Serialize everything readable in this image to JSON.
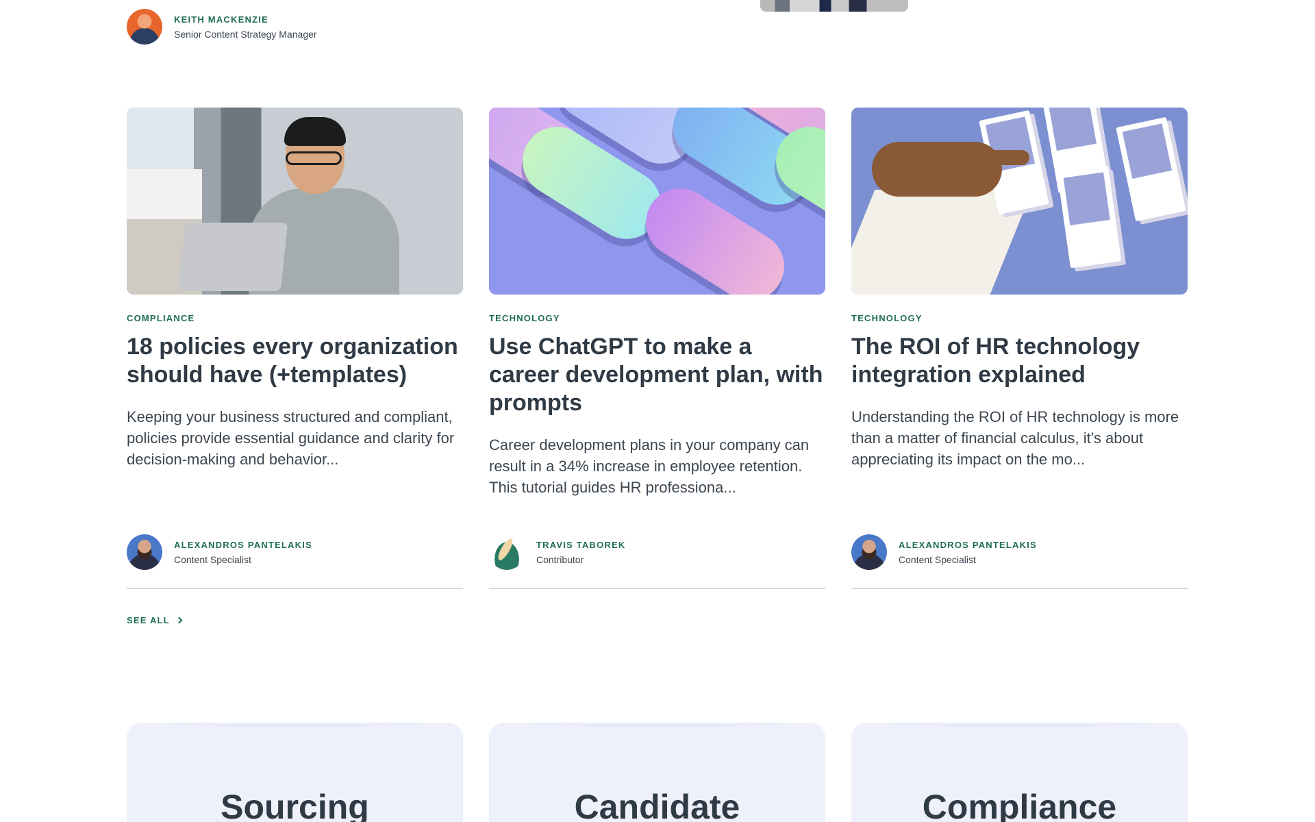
{
  "top_author": {
    "name": "KEITH MACKENZIE",
    "role": "Senior Content Strategy Manager"
  },
  "cards": [
    {
      "category": "COMPLIANCE",
      "title": "18 policies every organization should have (+templates)",
      "excerpt": "Keeping your business structured and compliant, policies provide essential guidance and clarity for decision-making and behavior...",
      "author": {
        "name": "ALEXANDROS PANTELAKIS",
        "role": "Content Specialist"
      }
    },
    {
      "category": "TECHNOLOGY",
      "title": "Use ChatGPT to make a career development plan, with prompts",
      "excerpt": "Career development plans in your company can result in a 34% increase in employee retention. This tutorial guides HR professiona...",
      "author": {
        "name": "TRAVIS TABOREK",
        "role": "Contributor"
      }
    },
    {
      "category": "TECHNOLOGY",
      "title": "The ROI of HR technology integration explained",
      "excerpt": "Understanding the ROI of HR technology is more than a matter of financial calculus, it's about appreciating its impact on the mo...",
      "author": {
        "name": "ALEXANDROS PANTELAKIS",
        "role": "Content Specialist"
      }
    }
  ],
  "see_all": {
    "label": "SEE ALL",
    "icon": "chevron-right-icon"
  },
  "topics": [
    {
      "title": "Sourcing"
    },
    {
      "title": "Candidate"
    },
    {
      "title": "Compliance"
    }
  ],
  "colors": {
    "accent": "#1f6c57",
    "text": "#2f3a45",
    "topic_bg": "#eef0fb",
    "rule": "#d2dde2"
  }
}
